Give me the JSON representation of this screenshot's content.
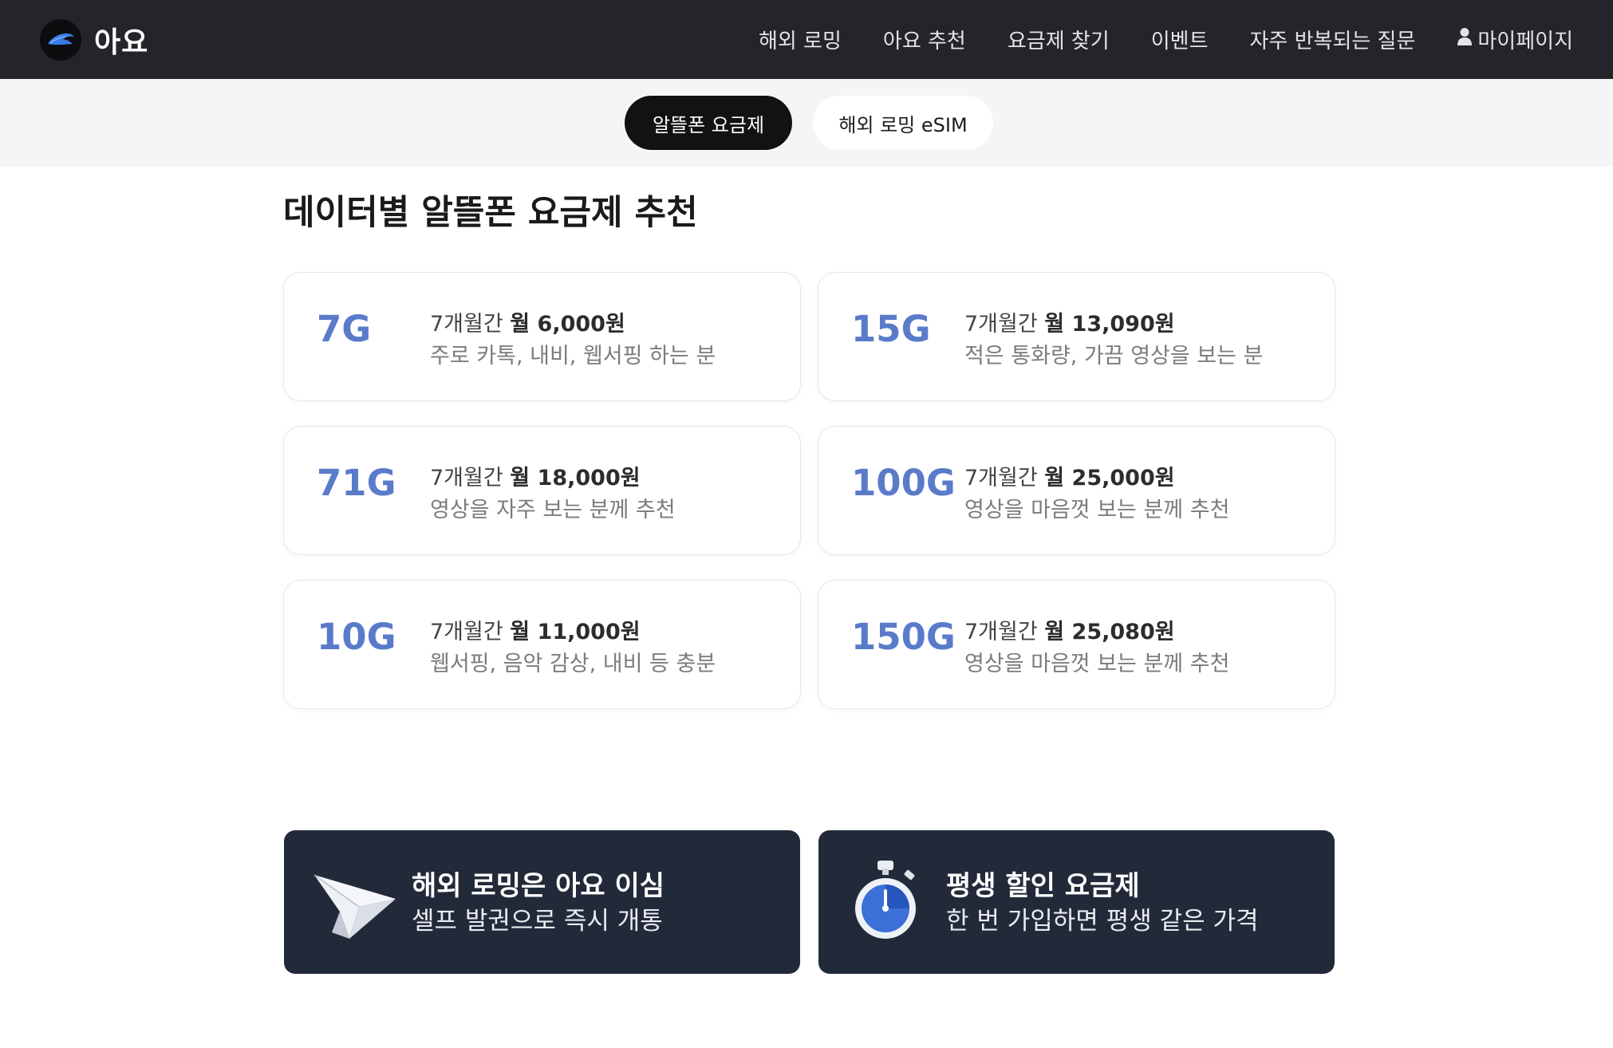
{
  "brand": {
    "name": "아요"
  },
  "nav": {
    "items": [
      "해외 로밍",
      "아요 추천",
      "요금제 찾기",
      "이벤트",
      "자주 반복되는 질문",
      "마이페이지"
    ]
  },
  "tabs": {
    "active": "알뜰폰 요금제",
    "inactive": "해외 로밍 eSIM"
  },
  "section": {
    "title": "데이터별 알뜰폰 요금제 추천"
  },
  "plans": [
    {
      "data": "7G",
      "period": "7개월간",
      "price": "월 6,000원",
      "desc": "주로 카톡, 내비, 웹서핑 하는 분"
    },
    {
      "data": "15G",
      "period": "7개월간",
      "price": "월 13,090원",
      "desc": "적은 통화량, 가끔 영상을 보는 분"
    },
    {
      "data": "71G",
      "period": "7개월간",
      "price": "월 18,000원",
      "desc": "영상을 자주 보는 분께 추천"
    },
    {
      "data": "100G",
      "period": "7개월간",
      "price": "월 25,000원",
      "desc": "영상을 마음껏 보는 분께 추천"
    },
    {
      "data": "10G",
      "period": "7개월간",
      "price": "월 11,000원",
      "desc": "웹서핑, 음악 감상, 내비 등 충분"
    },
    {
      "data": "150G",
      "period": "7개월간",
      "price": "월 25,080원",
      "desc": "영상을 마음껏 보는 분께 추천"
    }
  ],
  "banners": [
    {
      "title": "해외 로밍은 아요 이심",
      "subtitle": "셀프 발권으로 즉시 개통",
      "icon": "paper-plane-icon"
    },
    {
      "title": "평생 할인 요금제",
      "subtitle": "한 번 가입하면 평생 같은 가격",
      "icon": "stopwatch-icon"
    }
  ],
  "colors": {
    "accent": "#5a7bc9",
    "header_bg": "#24252a",
    "banner_bg": "#222a3a"
  }
}
